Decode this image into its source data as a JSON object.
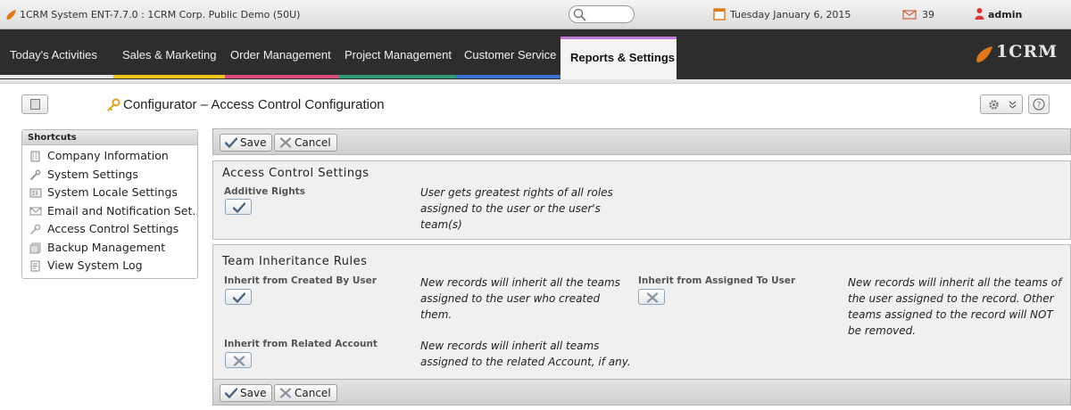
{
  "topbar": {
    "app_title": "1CRM System ENT-7.7.0 : 1CRM Corp. Public Demo (50U)",
    "date": "Tuesday January 6, 2015",
    "mail_count": "39",
    "user_name": "admin"
  },
  "nav": {
    "items": [
      "Today's Activities",
      "Sales & Marketing",
      "Order Management",
      "Project Management",
      "Customer Service",
      "Reports & Settings"
    ],
    "active": "Reports & Settings",
    "stripe_colors": [
      "#e6e6e6",
      "#f0c419",
      "#d94b7b",
      "#2f9b76",
      "#3c6fd6",
      "#8a6ad3"
    ],
    "brand": "1CRM"
  },
  "page": {
    "title": "Configurator – Access Control Configuration"
  },
  "shortcuts": {
    "header": "Shortcuts",
    "items": [
      {
        "label": "Company Information",
        "icon": "building-icon"
      },
      {
        "label": "System Settings",
        "icon": "wrench-icon"
      },
      {
        "label": "System Locale Settings",
        "icon": "locale-icon"
      },
      {
        "label": "Email and Notification Set...",
        "icon": "envelope-icon"
      },
      {
        "label": "Access Control Settings",
        "icon": "key-icon"
      },
      {
        "label": "Backup Management",
        "icon": "backup-icon"
      },
      {
        "label": "View System Log",
        "icon": "log-icon"
      }
    ]
  },
  "buttons": {
    "save": "Save",
    "cancel": "Cancel"
  },
  "access_control": {
    "title": "Access Control Settings",
    "additive_rights": {
      "label": "Additive Rights",
      "checked": true,
      "description": "User gets greatest rights of all roles assigned to the user or the user's team(s)"
    }
  },
  "team_inheritance": {
    "title": "Team Inheritance Rules",
    "created_by": {
      "label": "Inherit from Created By User",
      "checked": true,
      "description": "New records will inherit all the teams assigned to the user who created them."
    },
    "assigned_to": {
      "label": "Inherit from Assigned To User",
      "checked": false,
      "description": "New records will inherit all the teams of the user assigned to the record. Other teams assigned to the record will NOT be removed."
    },
    "related_account": {
      "label": "Inherit from Related Account",
      "checked": false,
      "description": "New records will inherit all teams assigned to the related Account, if any."
    }
  }
}
